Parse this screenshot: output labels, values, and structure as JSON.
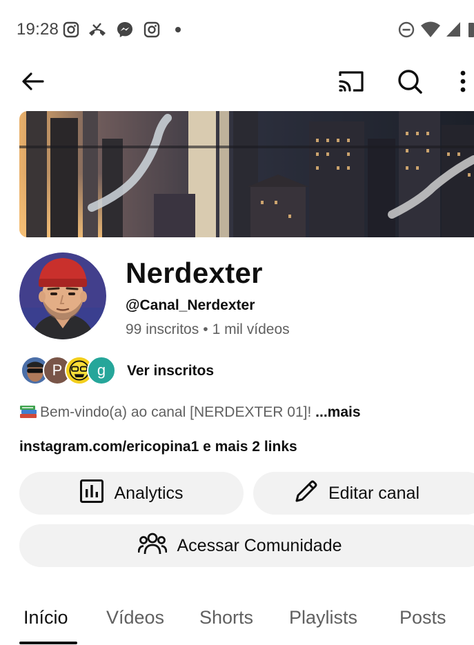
{
  "status_bar": {
    "time": "19:28",
    "notification_icons": [
      "instagram-icon",
      "missed-call-icon",
      "messenger-icon",
      "instagram-icon",
      "dot-icon"
    ],
    "system_icons": [
      "do-not-disturb-icon",
      "wifi-icon",
      "cellular-signal-icon",
      "battery-icon"
    ]
  },
  "app_bar": {
    "back_icon": "arrow-left-icon",
    "actions": [
      "cast-icon",
      "search-icon",
      "more-vert-icon"
    ]
  },
  "channel": {
    "name": "Nerdexter",
    "handle": "@Canal_Nerdexter",
    "subscribers": "99 inscritos",
    "separator": "•",
    "videos": "1 mil vídeos",
    "ver_inscritos": "Ver inscritos",
    "subscriber_avatar_letters": [
      "P",
      "g"
    ],
    "description": "Bem-vindo(a) ao canal [NERDEXTER 01]!",
    "description_more": "...mais",
    "links": "instagram.com/ericopina1 e mais 2 links"
  },
  "buttons": {
    "analytics": "Analytics",
    "editar_canal": "Editar canal",
    "acessar_comunidade": "Acessar Comunidade"
  },
  "tabs": [
    {
      "label": "Início",
      "active": true
    },
    {
      "label": "Vídeos",
      "active": false
    },
    {
      "label": "Shorts",
      "active": false
    },
    {
      "label": "Playlists",
      "active": false
    },
    {
      "label": "Posts",
      "active": false
    }
  ],
  "colors": {
    "text_primary": "#0f0f0f",
    "text_secondary": "#606060",
    "button_bg": "#f2f2f2",
    "avatar_bg": "#3a3f8f",
    "hat_red": "#c9302c",
    "sub_avatar_p": "#795548",
    "sub_avatar_g": "#26a69a"
  }
}
